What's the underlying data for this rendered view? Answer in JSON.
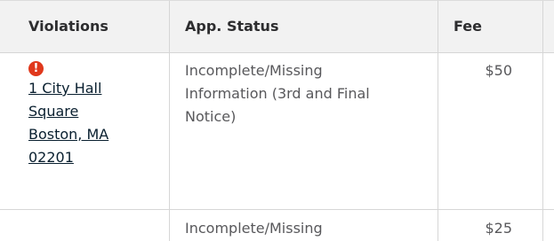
{
  "table": {
    "headers": {
      "violations": "Violations",
      "app_status": "App. Status",
      "fee": "Fee"
    },
    "rows": [
      {
        "alert_icon": "exclamation-circle-icon",
        "address_lines": [
          "1 City Hall",
          "Square",
          "Boston, MA",
          "02201"
        ],
        "status_lines": [
          "Incomplete/Missing",
          "Information (3rd and Final",
          "Notice)"
        ],
        "fee": "$50"
      },
      {
        "status_lines": [
          "Incomplete/Missing"
        ],
        "fee": "$25"
      }
    ]
  },
  "colors": {
    "header_bg": "#f2f2f2",
    "border": "#d6d6d6",
    "alert": "#e0381c",
    "link": "#091f2f",
    "text": "#58585b"
  }
}
